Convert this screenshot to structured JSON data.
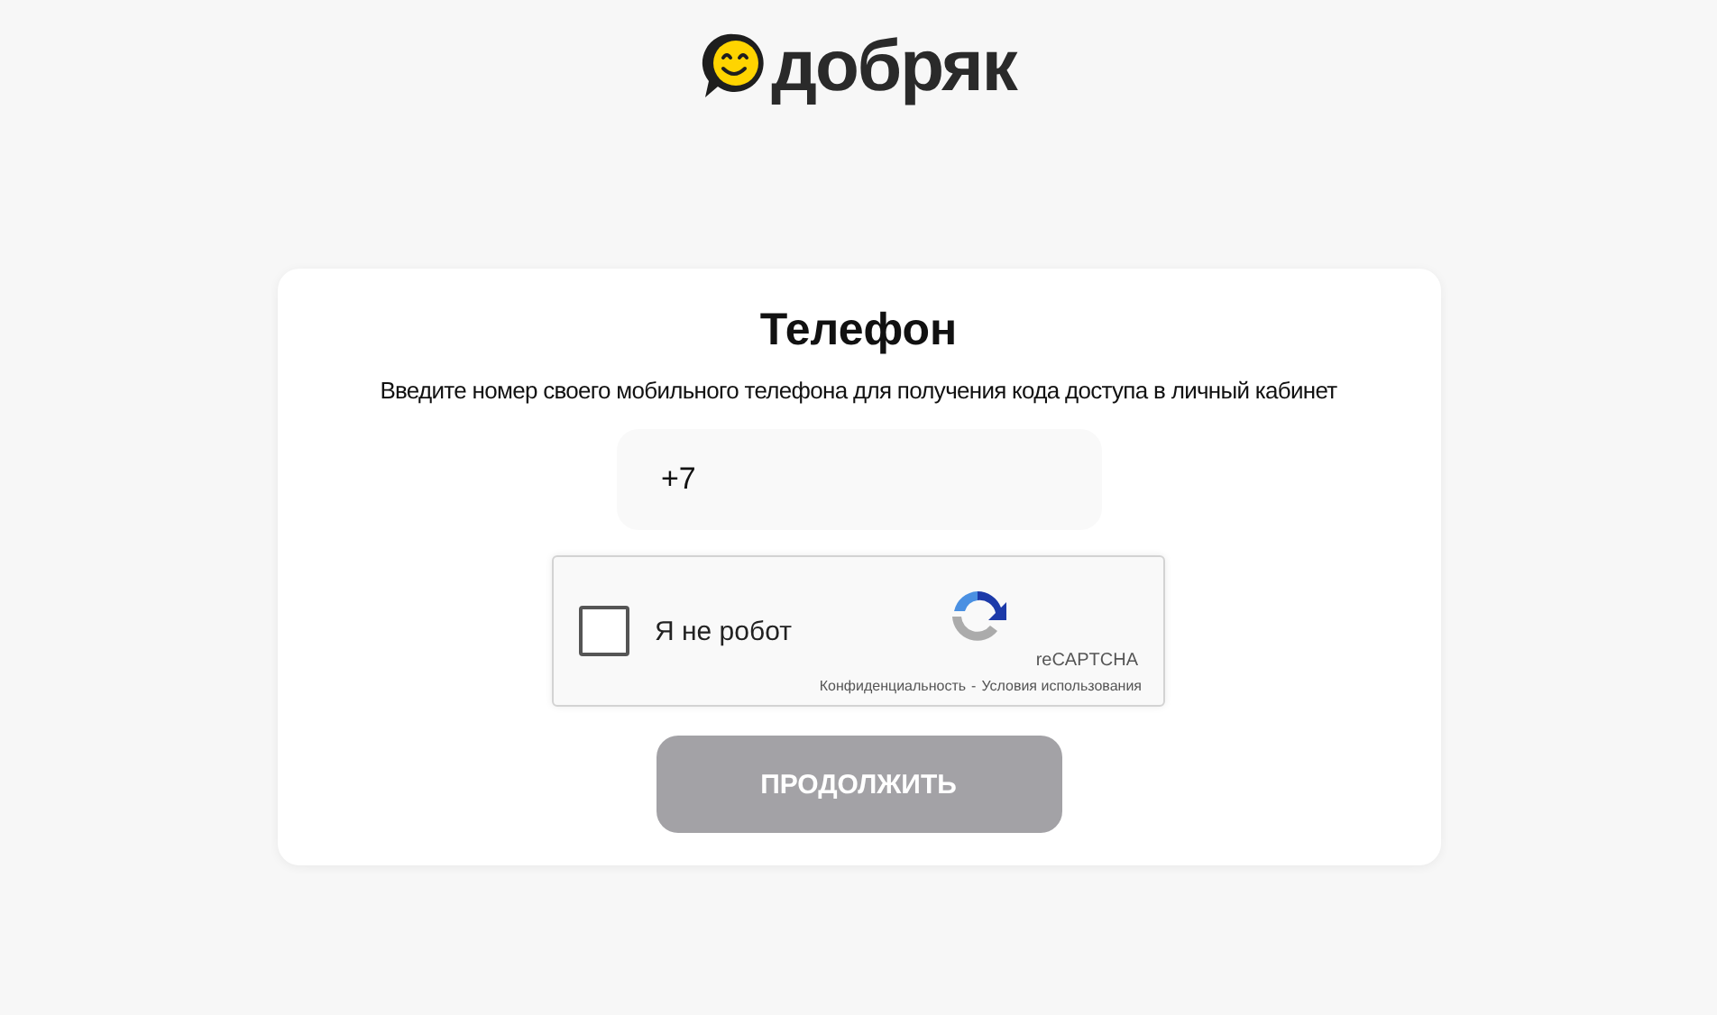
{
  "logo": {
    "text": "добряк"
  },
  "card": {
    "title": "Телефон",
    "subtitle": "Введите номер своего мобильного телефона для получения кода доступа в личный кабинет",
    "phone": {
      "value": "+7"
    },
    "captcha": {
      "label": "Я не робот",
      "checked": false,
      "brand": "reCAPTCHA",
      "privacy": "Конфиденциальность",
      "separator": "-",
      "terms": "Условия использования"
    },
    "button": {
      "label": "ПРОДОЛЖИТЬ",
      "disabled": true
    }
  }
}
